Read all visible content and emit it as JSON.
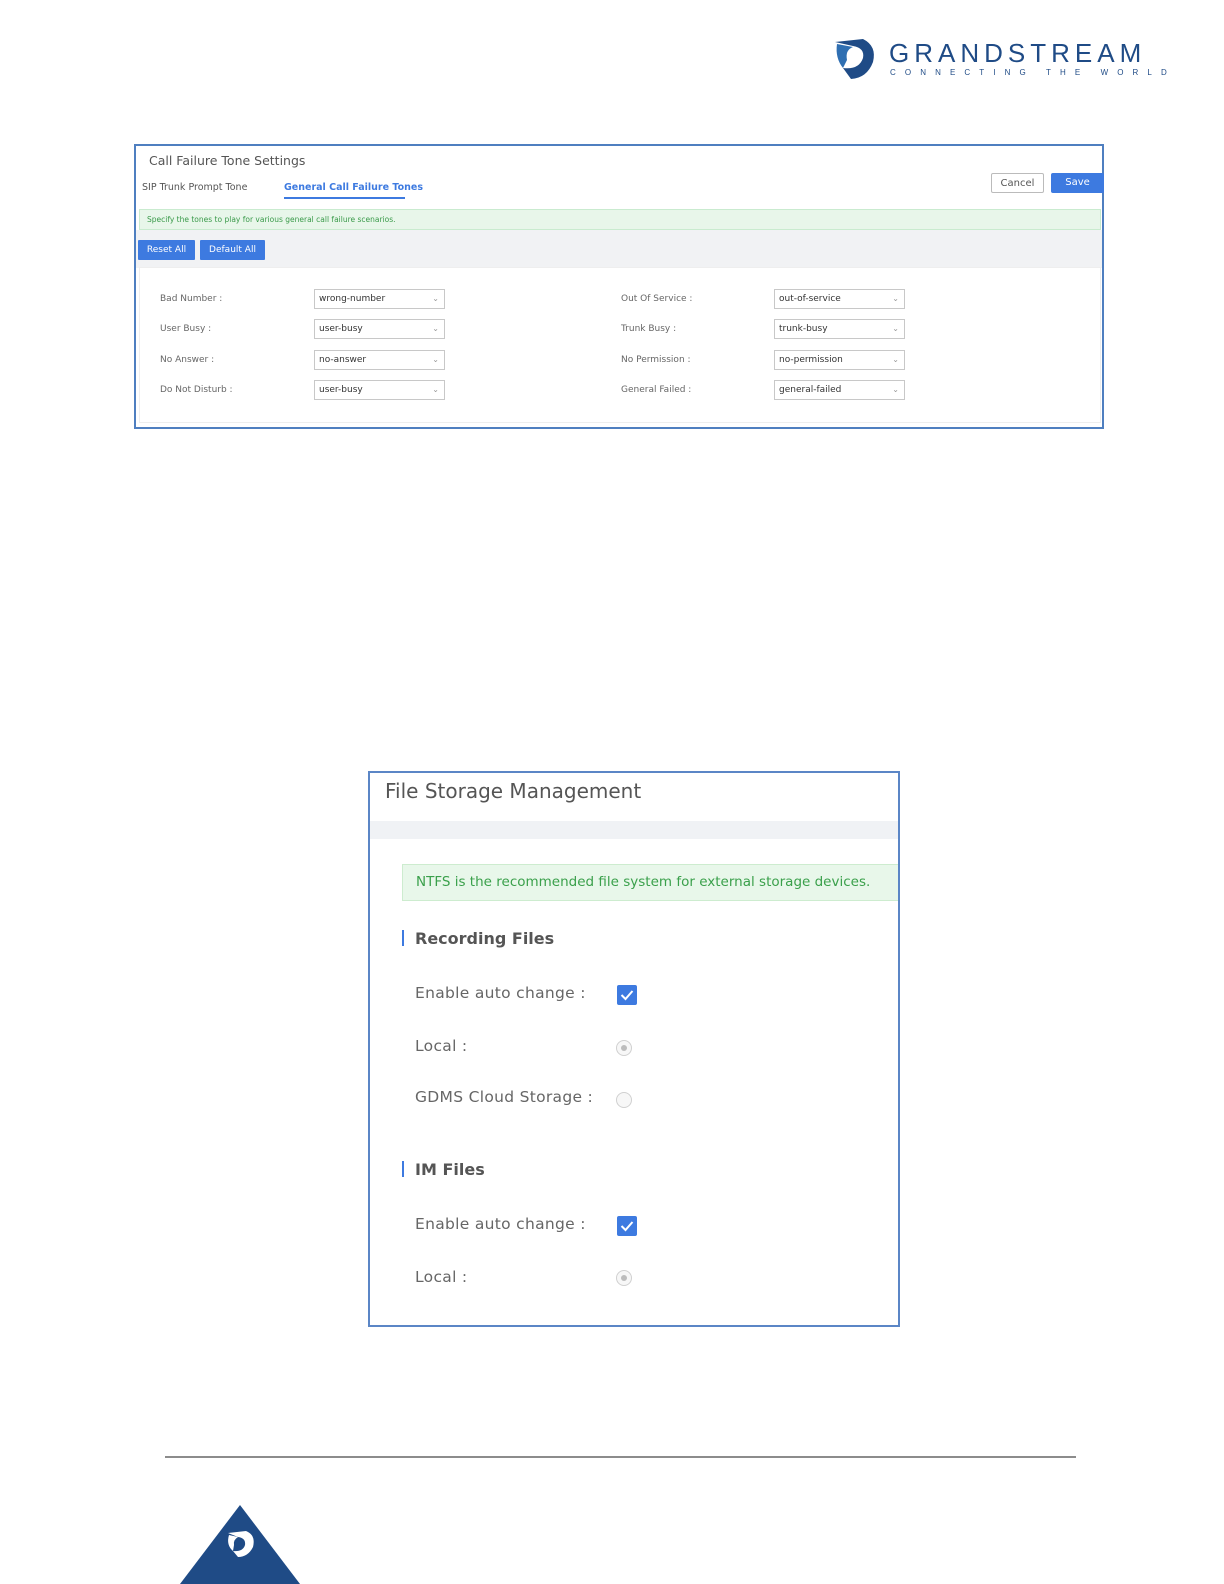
{
  "logo": {
    "brand": "GRANDSTREAM",
    "tagline": "CONNECTING THE WORLD",
    "brand_color": "#1f4b86"
  },
  "call_failure": {
    "title": "Call Failure Tone Settings",
    "tabs": [
      {
        "label": "SIP Trunk Prompt Tone",
        "active": false
      },
      {
        "label": "General Call Failure Tones",
        "active": true
      }
    ],
    "cancel_label": "Cancel",
    "save_label": "Save",
    "info": "Specify the tones to play for various general call failure scenarios.",
    "reset_all_label": "Reset All",
    "default_all_label": "Default All",
    "fields_left": [
      {
        "label": "Bad Number :",
        "value": "wrong-number"
      },
      {
        "label": "User Busy :",
        "value": "user-busy"
      },
      {
        "label": "No Answer :",
        "value": "no-answer"
      },
      {
        "label": "Do Not Disturb :",
        "value": "user-busy"
      }
    ],
    "fields_right": [
      {
        "label": "Out Of Service :",
        "value": "out-of-service"
      },
      {
        "label": "Trunk Busy :",
        "value": "trunk-busy"
      },
      {
        "label": "No Permission :",
        "value": "no-permission"
      },
      {
        "label": "General Failed :",
        "value": "general-failed"
      }
    ]
  },
  "file_storage": {
    "title": "File Storage Management",
    "info": "NTFS is the recommended file system for external storage devices.",
    "recording": {
      "heading": "Recording Files",
      "enable_label": "Enable auto change :",
      "enable_checked": true,
      "local_label": "Local :",
      "local_selected": true,
      "gdms_label": "GDMS Cloud Storage :",
      "gdms_selected": false
    },
    "im": {
      "heading": "IM Files",
      "enable_label": "Enable auto change :",
      "enable_checked": true,
      "local_label": "Local :",
      "local_selected": true
    }
  },
  "colors": {
    "accent": "#3d7ae0",
    "success": "#3aa04b"
  }
}
